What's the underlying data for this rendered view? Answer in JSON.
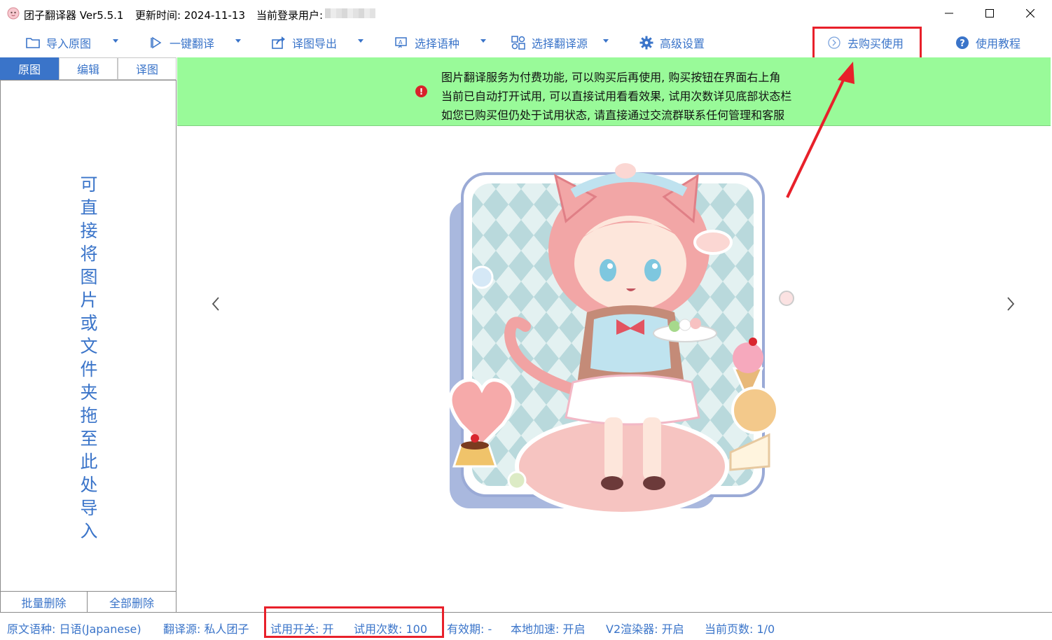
{
  "titlebar": {
    "app_title": "团子翻译器 Ver5.5.1",
    "update_time": "更新时间: 2024-11-13",
    "current_user_label": "当前登录用户:"
  },
  "toolbar": {
    "import": "导入原图",
    "translate": "一键翻译",
    "export": "译图导出",
    "language": "选择语种",
    "source": "选择翻译源",
    "settings": "高级设置",
    "buy": "去购买使用",
    "tutorial": "使用教程"
  },
  "left_panel": {
    "tabs": [
      "原图",
      "编辑",
      "译图"
    ],
    "drop_hint": "可直接将图片或文件夹拖至此处导入",
    "batch_delete": "批量删除",
    "delete_all": "全部删除"
  },
  "notice": {
    "line1": "图片翻译服务为付费功能, 可以购买后再使用, 购买按钮在界面右上角",
    "line2": "当前已自动打开试用, 可以直接试用看看效果, 试用次数详见底部状态栏",
    "line3": "如您已购买但仍处于试用状态, 请直接通过交流群联系任何管理和客服"
  },
  "statusbar": {
    "source_lang": "原文语种:  日语(Japanese)",
    "translate_source": "翻译源:  私人团子",
    "trial_switch": "试用开关:  开",
    "trial_count": "试用次数:  100",
    "validity": "有效期:  -",
    "local_accel": "本地加速:  开启",
    "v2_renderer": "V2渲染器:  开启",
    "current_page": "当前页数:  1/0"
  },
  "colors": {
    "accent": "#3a74c9",
    "notice_bg": "#99fa99",
    "highlight": "#e8202a"
  },
  "icons": {
    "import": "folder-icon",
    "translate": "play-icon",
    "export": "share-icon",
    "language": "language-icon",
    "source": "source-icon",
    "settings": "gear-icon",
    "buy": "circle-chevron-icon",
    "tutorial": "help-icon",
    "notice": "error-icon"
  }
}
